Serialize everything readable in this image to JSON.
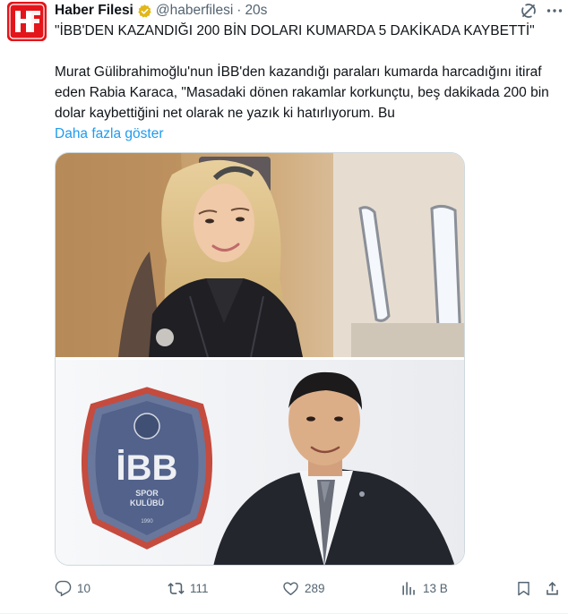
{
  "account": {
    "display_name": "Haber Filesi",
    "handle": "@haberfilesi",
    "separator": "·",
    "time": "20s",
    "avatar_letters": "HF"
  },
  "post": {
    "headline": "\"İBB'DEN KAZANDIĞI 200 BİN DOLARI KUMARDA 5 DAKİKADA KAYBETTİ\"",
    "body": "Murat Gülibrahimoğlu'nun İBB'den kazandığı paraları kumarda harcadığını itiraf eden Rabia Karaca, \"Masadaki dönen rakamlar korkunçtu, beş dakikada 200 bin dolar kaybettiğini net olarak ne yazık ki hatırlıyorum. Bu",
    "show_more": "Daha fazla göster"
  },
  "media": {
    "logo_text": "İBB",
    "logo_sub1": "SPOR",
    "logo_sub2": "KULÜBÜ",
    "logo_year": "1990"
  },
  "actions": {
    "replies": "10",
    "reposts": "111",
    "likes": "289",
    "views": "13 B"
  },
  "colors": {
    "accent": "#1d9bf0",
    "muted": "#536471",
    "brand_red": "#e3151a",
    "verified_gold": "#e2b719"
  },
  "icons": {
    "verified": "verified-badge-icon",
    "grok": "grok-icon",
    "more": "more-options-icon",
    "reply": "reply-icon",
    "repost": "repost-icon",
    "like": "like-icon",
    "views": "views-icon",
    "bookmark": "bookmark-icon",
    "share": "share-icon"
  }
}
